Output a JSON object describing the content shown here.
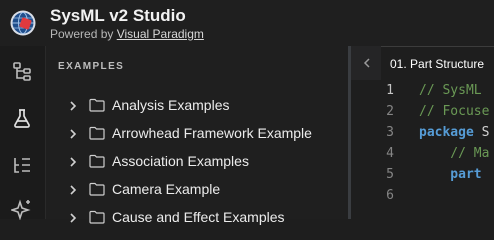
{
  "header": {
    "title": "SysML v2 Studio",
    "powered_by": "Powered by",
    "powered_link": "Visual Paradigm",
    "logo_icon": "globe-logo-icon"
  },
  "activity_bar": {
    "items": [
      {
        "icon": "hierarchy-icon"
      },
      {
        "icon": "flask-icon"
      },
      {
        "icon": "list-tree-icon"
      },
      {
        "icon": "sparkle-icon"
      }
    ]
  },
  "explorer": {
    "title": "EXAMPLES",
    "items": [
      {
        "label": "Analysis Examples"
      },
      {
        "label": "Arrowhead Framework Example"
      },
      {
        "label": "Association Examples"
      },
      {
        "label": "Camera Example"
      },
      {
        "label": "Cause and Effect Examples"
      }
    ]
  },
  "editor": {
    "tab_label": "01. Part Structure",
    "line_numbers": [
      "1",
      "2",
      "3",
      "4",
      "5",
      "6"
    ],
    "lines": [
      {
        "parts": [
          {
            "c": "cm",
            "t": "// SysML"
          }
        ]
      },
      {
        "parts": [
          {
            "c": "cm",
            "t": "// Focuse"
          }
        ]
      },
      {
        "parts": [
          {
            "c": "kw",
            "t": "package"
          },
          {
            "c": "id",
            "t": " S"
          }
        ]
      },
      {
        "parts": [
          {
            "c": "cm",
            "t": "    // Ma"
          }
        ]
      },
      {
        "parts": [
          {
            "c": "kw",
            "t": "    part"
          }
        ]
      },
      {
        "parts": [
          {
            "c": "id",
            "t": ""
          }
        ]
      }
    ]
  },
  "colors": {
    "background": "#1e1e1e",
    "comment": "#6a9955",
    "keyword": "#569cd6",
    "logo_red": "#e03a3e"
  }
}
